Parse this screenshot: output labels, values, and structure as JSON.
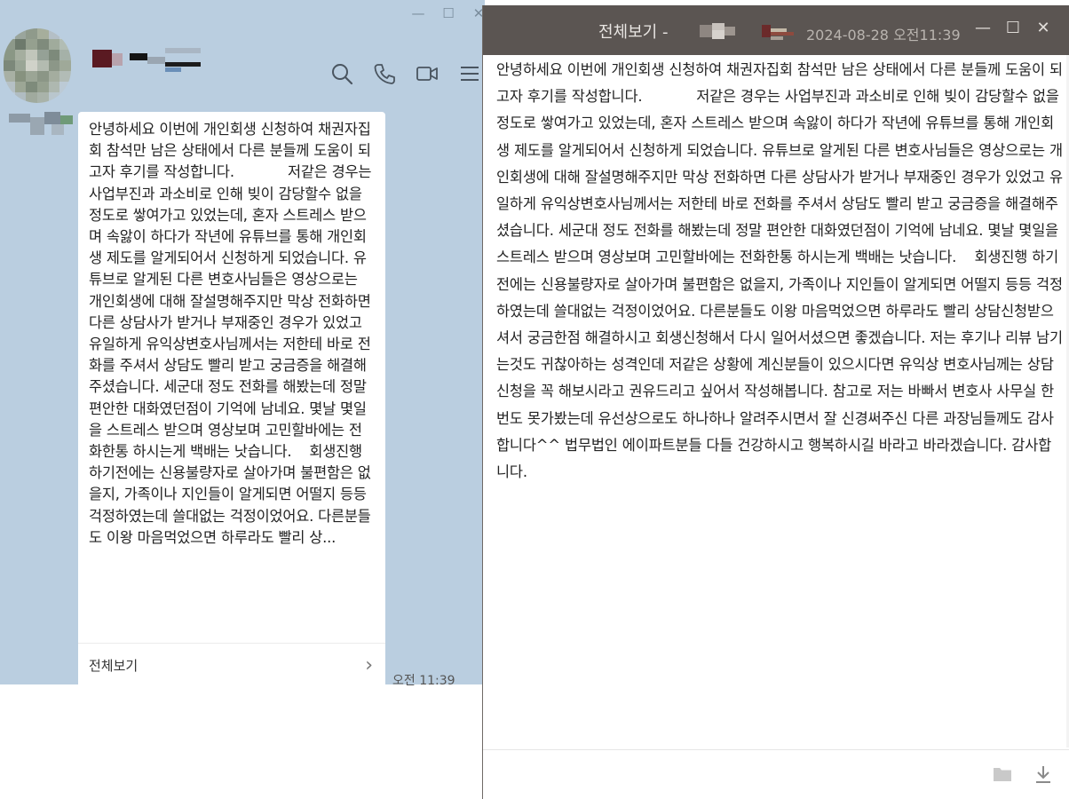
{
  "chat": {
    "window_controls": {
      "minimize": "—",
      "maximize": "☐",
      "close": "✕"
    },
    "icons": [
      "search-icon",
      "phone-icon",
      "video-icon",
      "menu-icon"
    ],
    "message": {
      "text": "안녕하세요 이번에 개인회생 신청하여 채권자집회 참석만 남은 상태에서 다른 분들께 도움이 되고자 후기를 작성합니다.            저같은 경우는 사업부진과 과소비로 인해 빚이 감당할수 없을정도로 쌓여가고 있었는데, 혼자 스트레스 받으며 속앓이 하다가 작년에 유튜브를 통해 개인회생 제도를 알게되어서 신청하게 되었습니다. 유튜브로 알게된 다른 변호사님들은 영상으로는 개인회생에 대해 잘설명해주지만 막상 전화하면 다른 상담사가 받거나 부재중인 경우가 있었고 유일하게 유익상변호사님께서는 저한테 바로 전화를 주셔서 상담도 빨리 받고 궁금증을 해결해주셨습니다. 세군대 정도 전화를 해봤는데 정말 편안한 대화였던점이 기억에 남네요. 몇날 몇일을 스트레스 받으며 영상보며 고민할바에는 전화한통 하시는게 백배는 낫습니다.    회생진행 하기전에는 신용불량자로 살아가며 불편함은 없을지, 가족이나 지인들이 알게되면 어떨지 등등 걱정하였는데 쓸대없는 걱정이었어요. 다른분들도 이왕 마음먹었으면 하루라도 빨리 상...",
      "view_all_label": "전체보기",
      "chevron": "›",
      "timestamp": "오전 11:39"
    }
  },
  "detail": {
    "title": "전체보기 -",
    "date": "2024-08-28 오전11:39",
    "window_controls": {
      "minimize": "—",
      "maximize": "☐",
      "close": "✕"
    },
    "body": "안녕하세요 이번에 개인회생 신청하여 채권자집회 참석만 남은 상태에서 다른 분들께 도움이 되고자 후기를 작성합니다.            저같은 경우는 사업부진과 과소비로 인해 빚이 감당할수 없을정도로 쌓여가고 있었는데, 혼자 스트레스 받으며 속앓이 하다가 작년에 유튜브를 통해 개인회생 제도를 알게되어서 신청하게 되었습니다. 유튜브로 알게된 다른 변호사님들은 영상으로는 개인회생에 대해 잘설명해주지만 막상 전화하면 다른 상담사가 받거나 부재중인 경우가 있었고 유일하게 유익상변호사님께서는 저한테 바로 전화를 주셔서 상담도 빨리 받고 궁금증을 해결해주셨습니다. 세군대 정도 전화를 해봤는데 정말 편안한 대화였던점이 기억에 남네요. 몇날 몇일을 스트레스 받으며 영상보며 고민할바에는 전화한통 하시는게 백배는 낫습니다.    회생진행 하기전에는 신용불량자로 살아가며 불편함은 없을지, 가족이나 지인들이 알게되면 어떨지 등등 걱정하였는데 쓸대없는 걱정이었어요. 다른분들도 이왕 마음먹었으면 하루라도 빨리 상담신청받으셔서 궁금한점 해결하시고 회생신청해서 다시 일어서셨으면 좋겠습니다. 저는 후기나 리뷰 남기는것도 귀찮아하는 성격인데 저같은 상황에 계신분들이 있으시다면 유익상 변호사님께는 상담신청을 꼭 해보시라고 권유드리고 싶어서 작성해봅니다. 참고로 저는 바빠서 변호사 사무실 한번도 못가봤는데 유선상으로도 하나하나 알려주시면서 잘 신경써주신 다른 과장님들께도 감사합니다^^ 법무법인 에이파트분들 다들 건강하시고 행복하시길 바라고 바라겠습니다. 감사합니다.",
    "footer_icons": [
      "folder-icon",
      "download-icon"
    ]
  },
  "colors": {
    "chat_background": "#bacee0",
    "titlebar": "#5b5552"
  }
}
